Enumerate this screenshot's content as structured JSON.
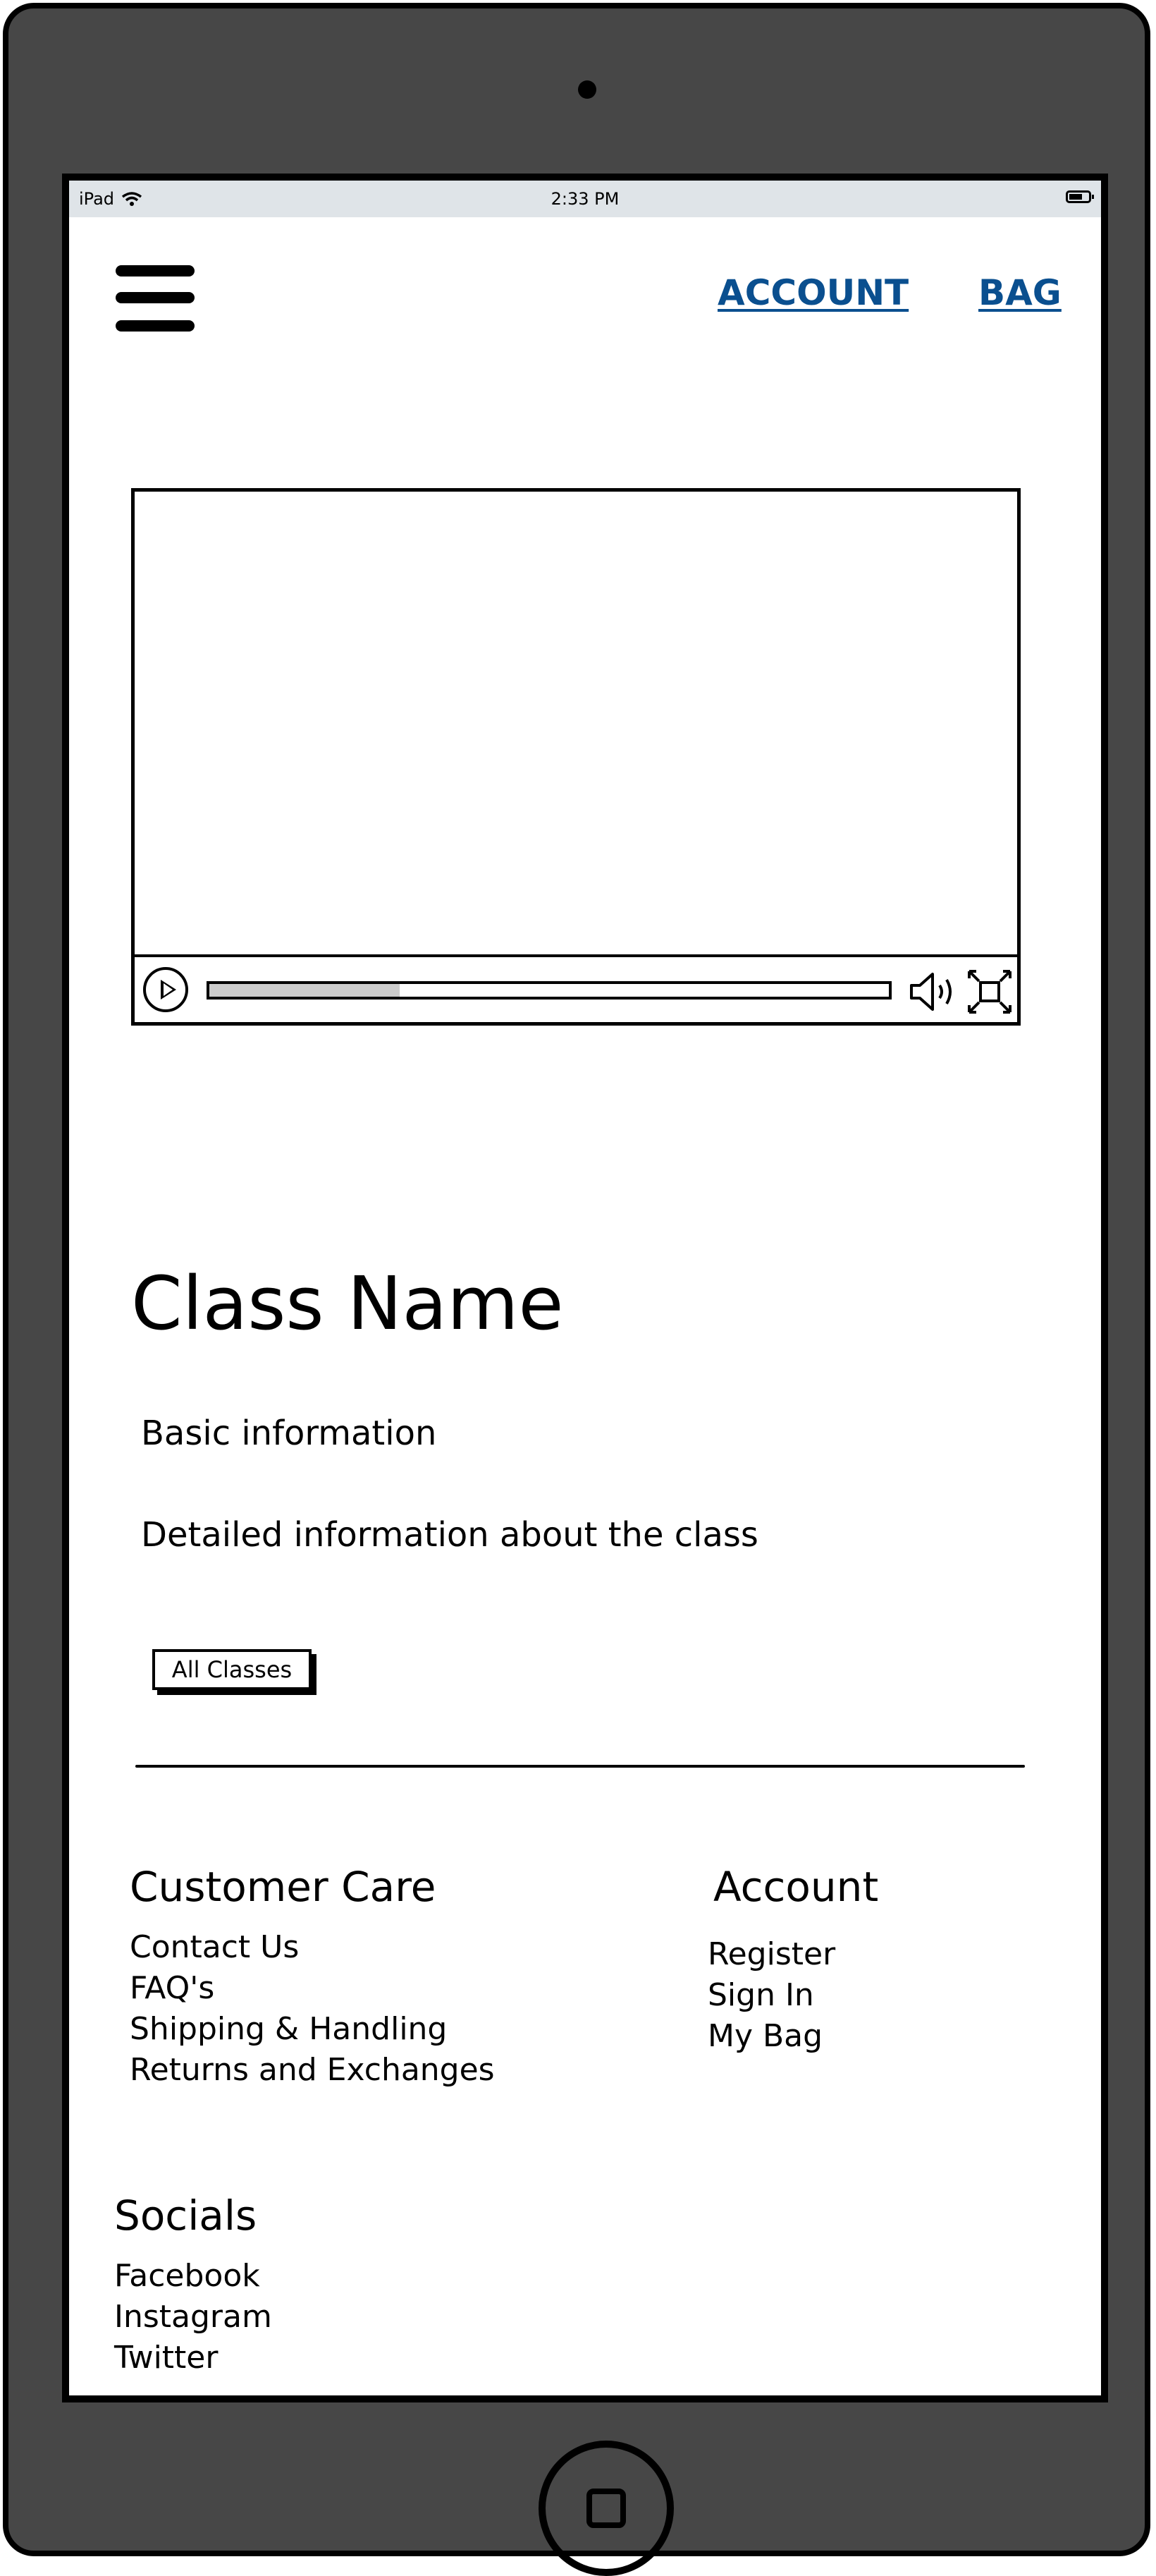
{
  "status_bar": {
    "device": "iPad",
    "time": "2:33 PM"
  },
  "header": {
    "account_label": "ACCOUNT",
    "bag_label": "BAG"
  },
  "video": {
    "progress": 0.28
  },
  "class": {
    "title": "Class Name",
    "basic_info": "Basic information",
    "detailed_info": "Detailed information about the class",
    "all_classes_button": "All Classes"
  },
  "footer": {
    "customer_care": {
      "heading": "Customer Care",
      "links": [
        "Contact Us",
        "FAQ's",
        "Shipping & Handling",
        "Returns and Exchanges"
      ]
    },
    "account": {
      "heading": "Account",
      "links": [
        "Register",
        "Sign In",
        "My Bag"
      ]
    },
    "socials": {
      "heading": "Socials",
      "links": [
        "Facebook",
        "Instagram",
        "Twitter"
      ]
    }
  },
  "colors": {
    "link": "#0a4f8f",
    "device_frame": "#474747",
    "status_bar": "#dfe4e8"
  },
  "icons": [
    "wifi-icon",
    "battery-icon",
    "hamburger-menu-icon",
    "play-icon",
    "volume-icon",
    "fullscreen-icon",
    "home-button-icon"
  ]
}
